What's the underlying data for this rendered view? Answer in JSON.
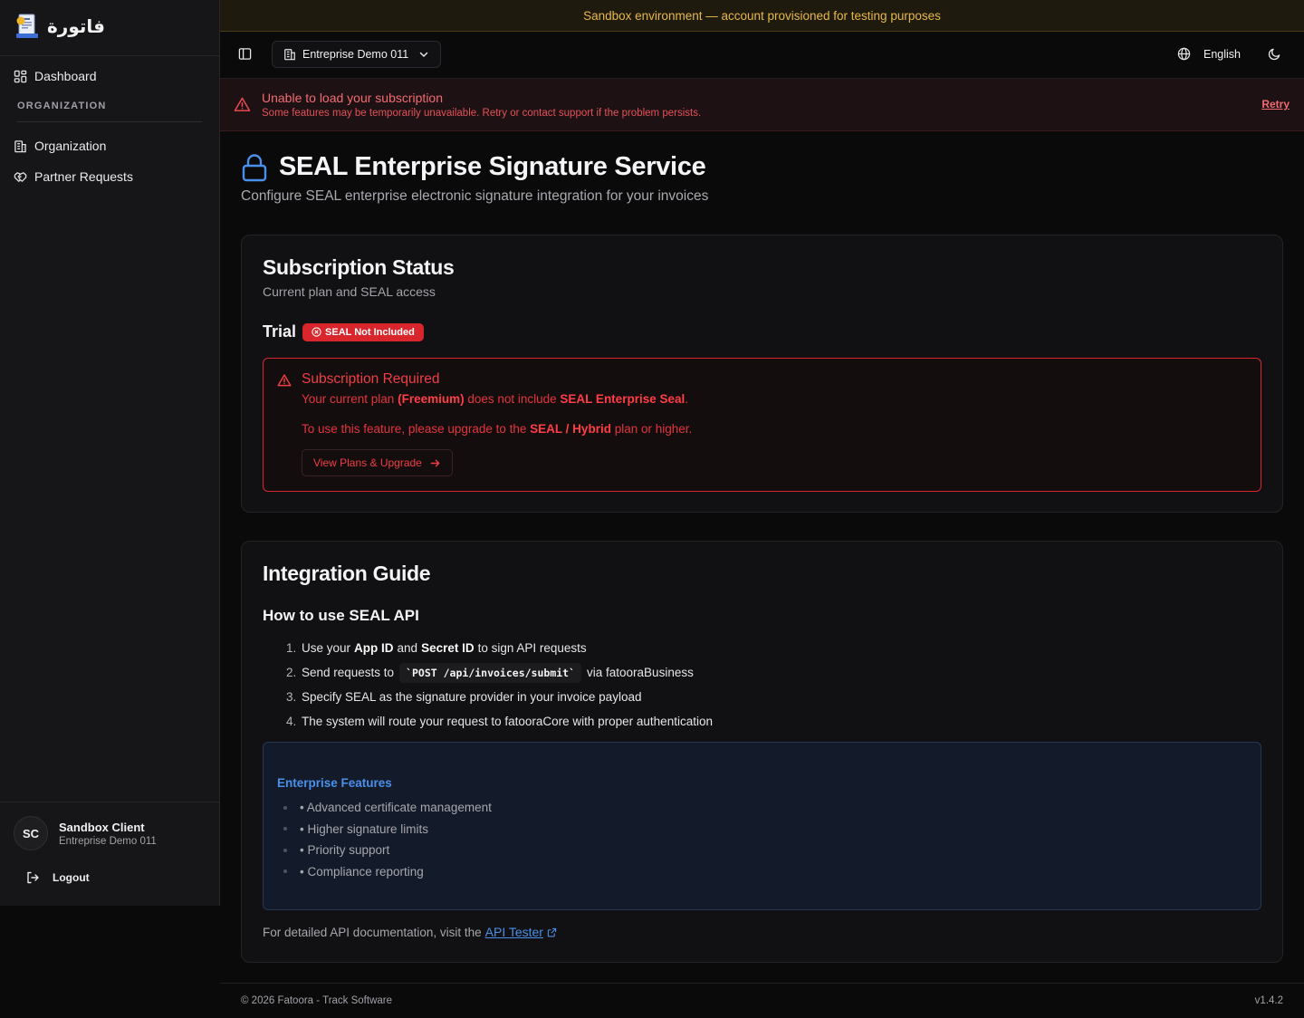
{
  "sidebar": {
    "logo_text": "فاتورة",
    "items": [
      {
        "label": "Dashboard",
        "icon": "grid-icon"
      },
      {
        "label": "Organization",
        "icon": "building-icon"
      },
      {
        "label": "Partner Requests",
        "icon": "handshake-icon"
      }
    ],
    "section_label": "ORGANIZATION",
    "user": {
      "initials": "SC",
      "name": "Sandbox Client",
      "org": "Entreprise Demo 011"
    },
    "logout_label": "Logout"
  },
  "sandbox_banner": "Sandbox environment — account provisioned for testing purposes",
  "header": {
    "org_select": "Entreprise Demo 011",
    "language": "English"
  },
  "error_banner": {
    "title": "Unable to load your subscription",
    "subtitle": "Some features may be temporarily unavailable. Retry or contact support if the problem persists.",
    "retry_label": "Retry"
  },
  "page": {
    "title": "SEAL Enterprise Signature Service",
    "subtitle": "Configure SEAL enterprise electronic signature integration for your invoices"
  },
  "subscription": {
    "title": "Subscription Status",
    "subtitle": "Current plan and SEAL access",
    "plan": "Trial",
    "badge": "SEAL Not Included",
    "alert": {
      "title": "Subscription Required",
      "line1_a": "Your current plan ",
      "line1_b": "(Freemium)",
      "line1_c": " does not include ",
      "line1_d": "SEAL Enterprise Seal",
      "line1_e": ".",
      "line2_a": "To use this feature, please upgrade to the ",
      "line2_b": "SEAL / Hybrid",
      "line2_c": " plan or higher.",
      "button": "View Plans & Upgrade"
    }
  },
  "guide": {
    "title": "Integration Guide",
    "heading": "How to use SEAL API",
    "steps": {
      "s1": {
        "n": "1.",
        "a": "Use your",
        "b": "App ID",
        "c": "and",
        "d": "Secret ID",
        "e": "to sign API requests"
      },
      "s2": {
        "n": "2.",
        "a": "Send requests to",
        "code": "`POST /api/invoices/submit`",
        "c": "via fatooraBusiness"
      },
      "s3": {
        "n": "3.",
        "a": "Specify SEAL as the signature provider in your invoice payload"
      },
      "s4": {
        "n": "4.",
        "a": "The system will route your request to fatooraCore with proper authentication"
      }
    },
    "features": {
      "title": "Enterprise Features",
      "items": [
        "• Advanced certificate management",
        "• Higher signature limits",
        "• Priority support",
        "• Compliance reporting"
      ]
    },
    "doc_text": "For detailed API documentation, visit the",
    "doc_link": "API Tester"
  },
  "footer": {
    "copyright": "© 2026 Fatoora - Track Software",
    "version": "v1.4.2"
  },
  "colors": {
    "accent_blue": "#4a90ea",
    "error_red": "#d9262c",
    "warning_amber": "#e6b84a"
  }
}
